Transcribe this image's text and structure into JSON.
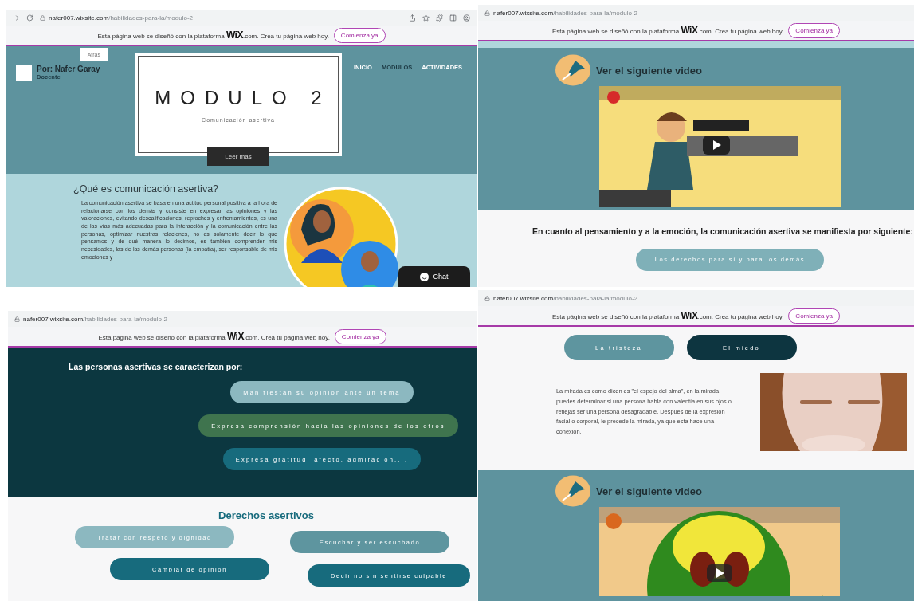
{
  "panels": [
    {
      "browser": {
        "kind": "full",
        "domain": "nafer007.wixsite.com",
        "path": "/habilidades-para-la/modulo-2"
      },
      "banner": {
        "text": "Esta página web se diseñó con la plataforma **WiX**.com. Crea tu página web hoy.",
        "button": "Comienza ya"
      },
      "sections": [
        {
          "kind": "hero",
          "back": "Atrás",
          "author": "Por: Nafer Garay",
          "role": "Docente",
          "nav": [
            {
              "label": "INICIO",
              "selected": false
            },
            {
              "label": "MODULOS",
              "selected": true
            },
            {
              "label": "ACTIVIDADES",
              "selected": false
            }
          ],
          "title": "MODULO 2",
          "subtitle": "Comunicación asertiva",
          "button": "Leer más"
        },
        {
          "kind": "intro",
          "heading": "¿Qué es comunicación asertiva?",
          "text": "La comunicación asertiva se basa en una actitud personal positiva a la hora de relacionarse con los demás y consiste en expresar las opiniones y las valoraciones, evitando descalificaciones, reproches y enfrentamientos, es una de las vías más adecuadas para la interacción y la comunicación entre las personas, optimizar nuestras relaciones, no es solamente decir lo que pensamos y de qué manera lo decimos, es también comprender mis necesidades, las de las demás personas (la empatía), ser responsable de mis emociones y",
          "chat": "Chat"
        }
      ]
    },
    {
      "browser": {
        "kind": "compact",
        "domain": "nafer007.wixsite.com",
        "path": "/habilidades-para-la/modulo-2"
      },
      "banner": {
        "text": "Esta página web se diseñó con la plataforma **WiX**.com. Crea tu página web hoy.",
        "button": "Comienza ya"
      },
      "sections": [
        {
          "kind": "video",
          "heading": "Ver el siguiente video"
        },
        {
          "kind": "statement",
          "text": "En cuanto al pensamiento y a la emoción, la comunicación asertiva se manifiesta por siguiente:",
          "pills": [
            {
              "label": "Los derechos para sí y para los demás",
              "color": "#7fb0b8"
            }
          ]
        }
      ]
    },
    {
      "browser": {
        "kind": "compact",
        "domain": "nafer007.wixsite.com",
        "path": "/habilidades-para-la/modulo-2"
      },
      "banner": {
        "text": "Esta página web se diseñó con la plataforma **WiX**.com. Crea tu página web hoy.",
        "button": "Comienza ya"
      },
      "sections": [
        {
          "kind": "traits",
          "heading": "Las personas asertivas se caracterizan por:",
          "pills": [
            {
              "label": "Manifiestan su opinión ante un tema",
              "color": "#8cb8c0"
            },
            {
              "label": "Expresa comprensión hacia las opiniones de los otros",
              "color": "#3f744e"
            },
            {
              "label": "Expresa gratitud, afecto, admiración,...",
              "color": "#176b7d"
            }
          ]
        },
        {
          "kind": "rights",
          "heading": "Derechos asertivos",
          "pills": [
            {
              "label": "Tratar con respeto y dignidad",
              "color": "#8cb8c0"
            },
            {
              "label": "Escuchar y ser escuchado",
              "color": "#5e959f"
            },
            {
              "label": "Cambiar de opinión",
              "color": "#176b7d"
            },
            {
              "label": "Decir no sin sentirse culpable",
              "color": "#176b7d"
            }
          ]
        }
      ]
    },
    {
      "browser": {
        "kind": "compact",
        "domain": "nafer007.wixsite.com",
        "path": "/habilidades-para-la/modulo-2"
      },
      "banner": {
        "text": "Esta página web se diseñó con la plataforma **WiX**.com. Crea tu página web hoy.",
        "button": "Comienza ya"
      },
      "sections": [
        {
          "kind": "emotions",
          "pills": [
            {
              "label": "La tristeza",
              "color": "#5e959f"
            },
            {
              "label": "El miedo",
              "color": "#0d3540"
            }
          ],
          "text": "La mirada es como dicen es \"el espejo del alma\", en la mirada puedes determinar si una persona habla con valentía en sus ojos o reflejas ser una persona desagradable. Después de la expresión facial o corporal, le precede la mirada, ya que esta hace una conexión."
        },
        {
          "kind": "video",
          "heading": "Ver el siguiente video"
        }
      ]
    }
  ]
}
